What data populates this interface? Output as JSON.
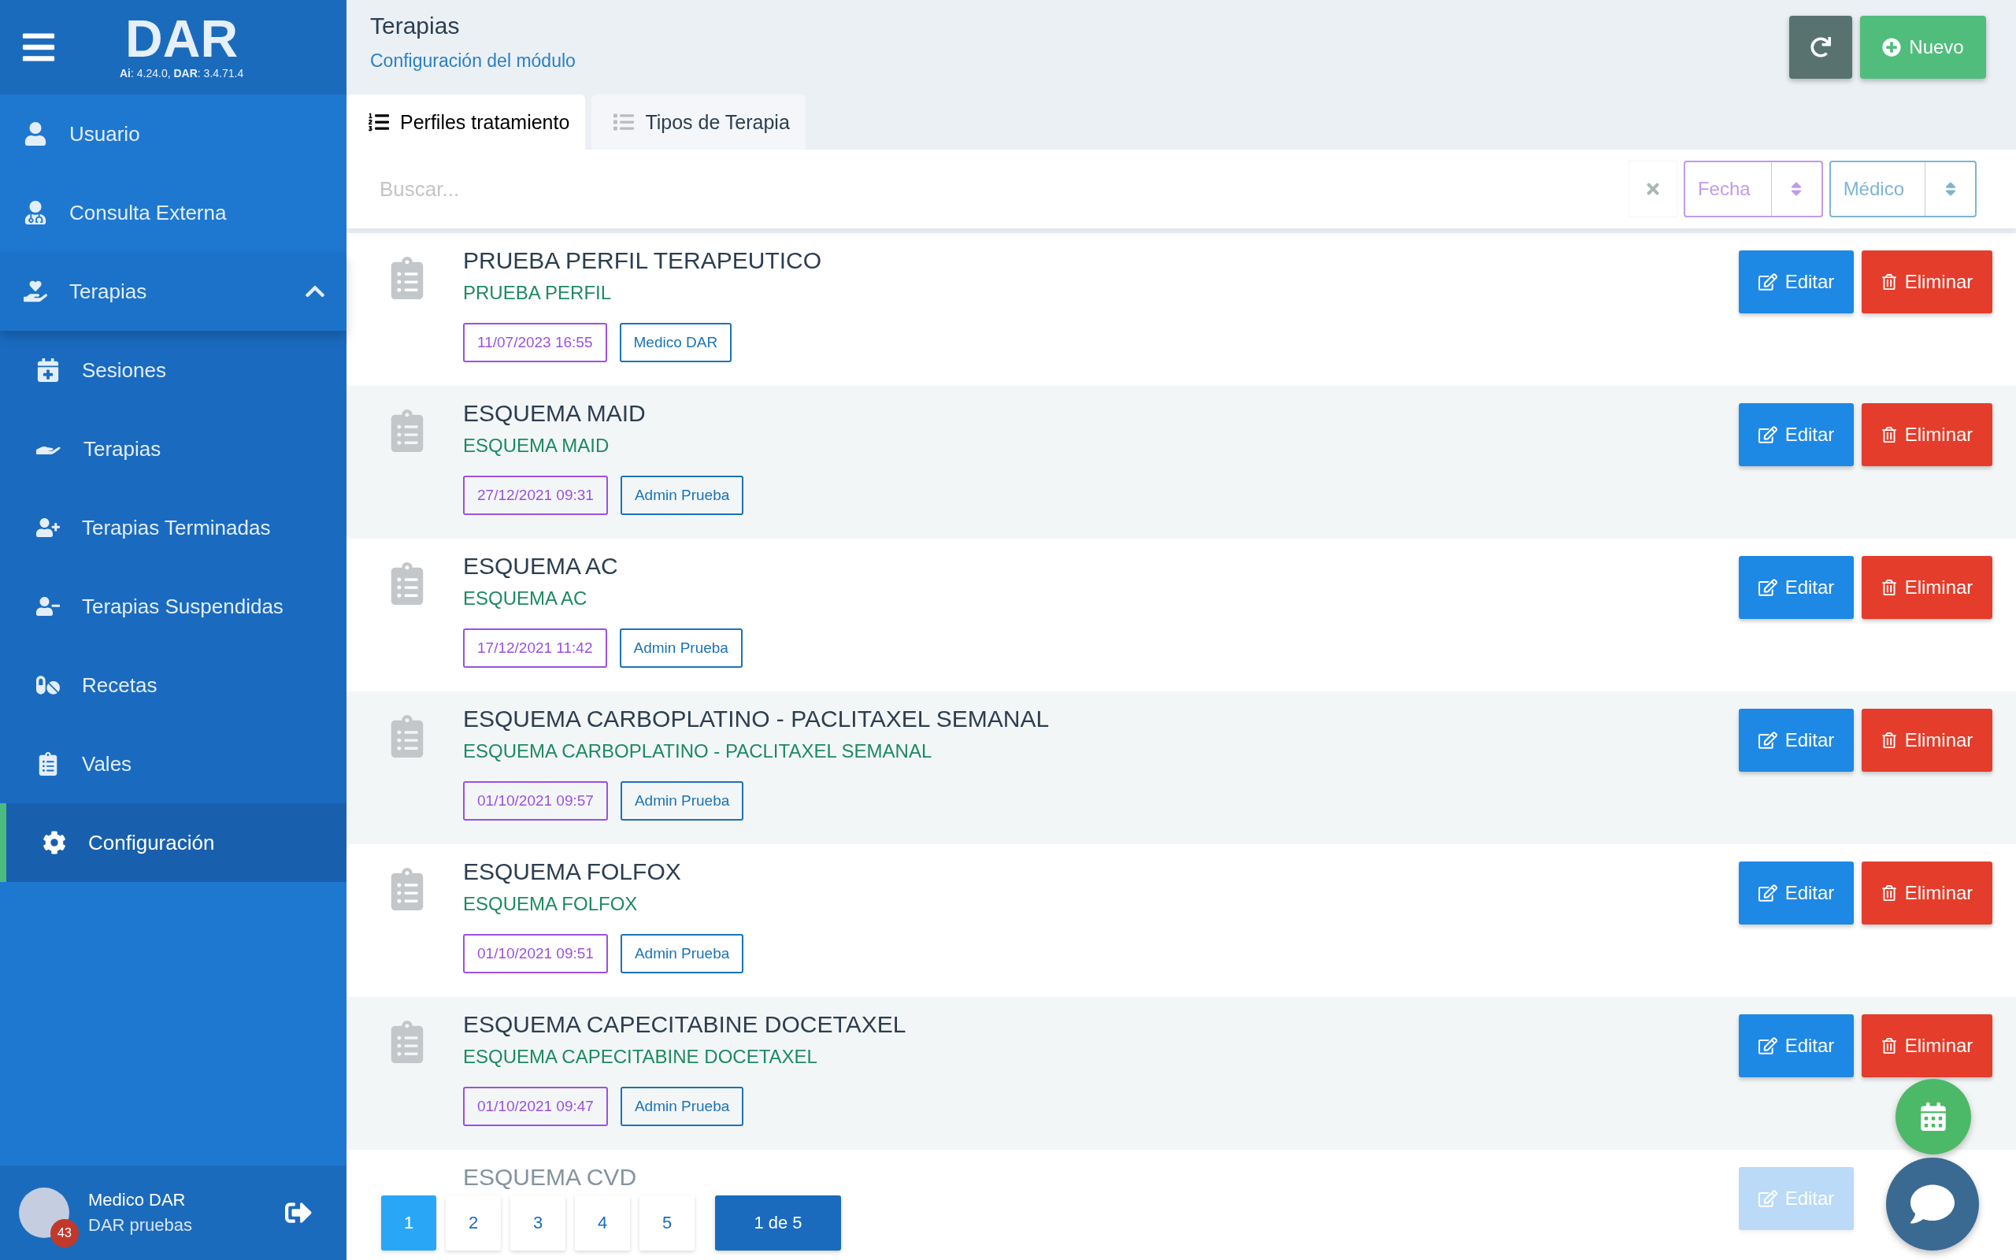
{
  "sidebar": {
    "logo": "DAR",
    "version": "**Ai**: 4.24.0, **DAR**: 3.4.71.4",
    "items": [
      {
        "label": "Usuario",
        "kind": "user",
        "selected": false
      },
      {
        "label": "Consulta Externa",
        "kind": "doctor",
        "selected": false
      },
      {
        "label": "Terapias",
        "kind": "therapy",
        "selected": false,
        "expanded": true,
        "children": [
          {
            "label": "Sesiones",
            "kind": "sessions",
            "selected": false
          },
          {
            "label": "Terapias",
            "kind": "therapies",
            "selected": false
          },
          {
            "label": "Terapias Terminadas",
            "kind": "finished",
            "selected": false
          },
          {
            "label": "Terapias Suspendidas",
            "kind": "suspended",
            "selected": false
          },
          {
            "label": "Recetas",
            "kind": "prescriptions",
            "selected": false
          },
          {
            "label": "Vales",
            "kind": "vouchers",
            "selected": false
          },
          {
            "label": "Configuración",
            "kind": "settings",
            "selected": true
          }
        ]
      }
    ],
    "user": {
      "name": "Medico DAR",
      "org": "DAR pruebas",
      "badge": "43"
    }
  },
  "header": {
    "title": "Terapias",
    "subtitle": "Configuración del módulo",
    "new_button": "Nuevo"
  },
  "tabs": [
    {
      "label": "Perfiles tratamiento",
      "selected": true
    },
    {
      "label": "Tipos de Terapia",
      "selected": false
    }
  ],
  "search": {
    "placeholder": "Buscar..."
  },
  "filters": [
    {
      "label": "Fecha",
      "color": "#c29be6"
    },
    {
      "label": "Médico",
      "color": "#7eb4d8"
    }
  ],
  "rows": [
    {
      "title": "PRUEBA PERFIL TERAPEUTICO",
      "subtitle": "PRUEBA PERFIL",
      "date": "11/07/2023 16:55",
      "doctor": "Medico DAR",
      "edit": "Editar",
      "delete": "Eliminar"
    },
    {
      "title": "ESQUEMA MAID",
      "subtitle": "ESQUEMA MAID",
      "date": "27/12/2021 09:31",
      "doctor": "Admin Prueba",
      "edit": "Editar",
      "delete": "Eliminar"
    },
    {
      "title": "ESQUEMA AC",
      "subtitle": "ESQUEMA AC",
      "date": "17/12/2021 11:42",
      "doctor": "Admin Prueba",
      "edit": "Editar",
      "delete": "Eliminar"
    },
    {
      "title": "ESQUEMA CARBOPLATINO - PACLITAXEL SEMANAL",
      "subtitle": "ESQUEMA CARBOPLATINO - PACLITAXEL SEMANAL",
      "date": "01/10/2021 09:57",
      "doctor": "Admin Prueba",
      "edit": "Editar",
      "delete": "Eliminar"
    },
    {
      "title": "ESQUEMA FOLFOX",
      "subtitle": "ESQUEMA FOLFOX",
      "date": "01/10/2021 09:51",
      "doctor": "Admin Prueba",
      "edit": "Editar",
      "delete": "Eliminar"
    },
    {
      "title": "ESQUEMA CAPECITABINE DOCETAXEL",
      "subtitle": "ESQUEMA CAPECITABINE DOCETAXEL",
      "date": "01/10/2021 09:47",
      "doctor": "Admin Prueba",
      "edit": "Editar",
      "delete": "Eliminar"
    },
    {
      "title": "ESQUEMA CVD",
      "edit": "Editar",
      "faded": true
    }
  ],
  "pagination": {
    "pages": [
      {
        "label": "1",
        "selected": true
      },
      {
        "label": "2",
        "selected": false
      },
      {
        "label": "3",
        "selected": false
      },
      {
        "label": "4",
        "selected": false
      },
      {
        "label": "5",
        "selected": false
      }
    ],
    "summary": "1 de 5"
  }
}
